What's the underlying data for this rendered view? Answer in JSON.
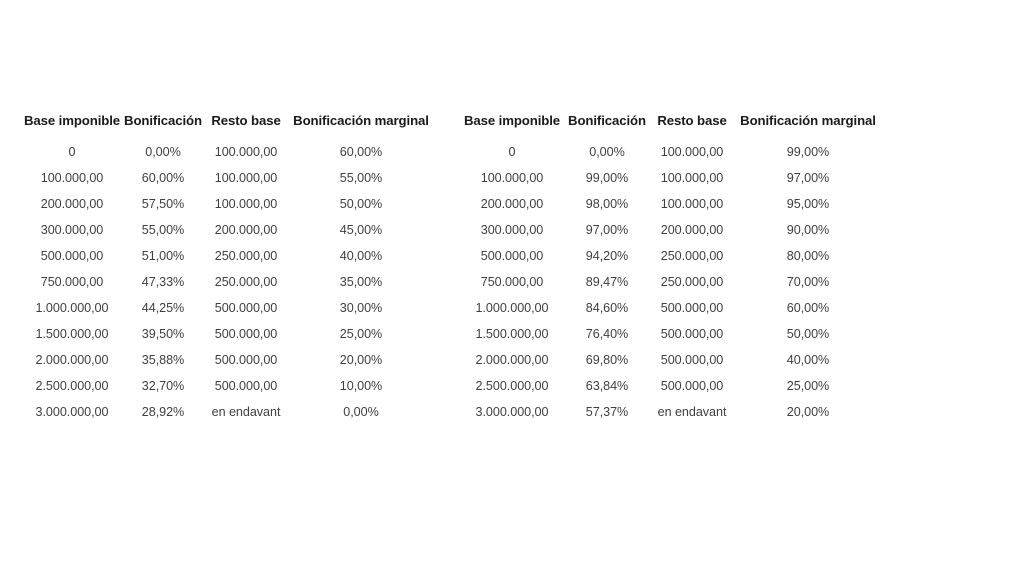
{
  "document": {
    "background_color": "#ffffff",
    "header_text_color": "#1a1a1a",
    "body_text_color": "#3f3f3f"
  },
  "tables": [
    {
      "id": "table-left",
      "name": "tabla-bonificacion-izquierda",
      "columns": [
        "Base imponible",
        "Bonificación",
        "Resto base",
        "Bonificación marginal"
      ],
      "rows": [
        [
          "0",
          "0,00%",
          "100.000,00",
          "60,00%"
        ],
        [
          "100.000,00",
          "60,00%",
          "100.000,00",
          "55,00%"
        ],
        [
          "200.000,00",
          "57,50%",
          "100.000,00",
          "50,00%"
        ],
        [
          "300.000,00",
          "55,00%",
          "200.000,00",
          "45,00%"
        ],
        [
          "500.000,00",
          "51,00%",
          "250.000,00",
          "40,00%"
        ],
        [
          "750.000,00",
          "47,33%",
          "250.000,00",
          "35,00%"
        ],
        [
          "1.000.000,00",
          "44,25%",
          "500.000,00",
          "30,00%"
        ],
        [
          "1.500.000,00",
          "39,50%",
          "500.000,00",
          "25,00%"
        ],
        [
          "2.000.000,00",
          "35,88%",
          "500.000,00",
          "20,00%"
        ],
        [
          "2.500.000,00",
          "32,70%",
          "500.000,00",
          "10,00%"
        ],
        [
          "3.000.000,00",
          "28,92%",
          "en endavant",
          "0,00%"
        ]
      ]
    },
    {
      "id": "table-right",
      "name": "tabla-bonificacion-derecha",
      "columns": [
        "Base imponible",
        "Bonificación",
        "Resto base",
        "Bonificación marginal"
      ],
      "rows": [
        [
          "0",
          "0,00%",
          "100.000,00",
          "99,00%"
        ],
        [
          "100.000,00",
          "99,00%",
          "100.000,00",
          "97,00%"
        ],
        [
          "200.000,00",
          "98,00%",
          "100.000,00",
          "95,00%"
        ],
        [
          "300.000,00",
          "97,00%",
          "200.000,00",
          "90,00%"
        ],
        [
          "500.000,00",
          "94,20%",
          "250.000,00",
          "80,00%"
        ],
        [
          "750.000,00",
          "89,47%",
          "250.000,00",
          "70,00%"
        ],
        [
          "1.000.000,00",
          "84,60%",
          "500.000,00",
          "60,00%"
        ],
        [
          "1.500.000,00",
          "76,40%",
          "500.000,00",
          "50,00%"
        ],
        [
          "2.000.000,00",
          "69,80%",
          "500.000,00",
          "40,00%"
        ],
        [
          "2.500.000,00",
          "63,84%",
          "500.000,00",
          "25,00%"
        ],
        [
          "3.000.000,00",
          "57,37%",
          "en endavant",
          "20,00%"
        ]
      ]
    }
  ]
}
